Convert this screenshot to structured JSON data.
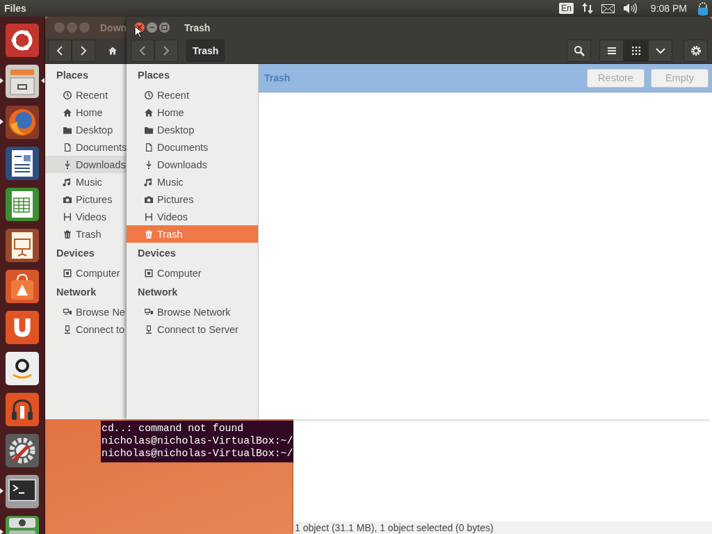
{
  "top_panel": {
    "app_name": "Files",
    "keyboard_layout": "En",
    "clock": "9:08 PM"
  },
  "launcher": [
    {
      "kind": "dash",
      "running": false,
      "focused": false
    },
    {
      "kind": "files",
      "running": true,
      "focused": true
    },
    {
      "kind": "firefox",
      "running": true,
      "focused": false
    },
    {
      "kind": "writer",
      "running": false,
      "focused": false
    },
    {
      "kind": "calc",
      "running": false,
      "focused": false
    },
    {
      "kind": "impress",
      "running": false,
      "focused": false
    },
    {
      "kind": "software",
      "running": false,
      "focused": false
    },
    {
      "kind": "ubuntu-one",
      "running": false,
      "focused": false
    },
    {
      "kind": "amazon",
      "running": false,
      "focused": false
    },
    {
      "kind": "music-store",
      "running": false,
      "focused": false
    },
    {
      "kind": "settings",
      "running": false,
      "focused": false
    },
    {
      "kind": "terminal",
      "running": true,
      "focused": false
    },
    {
      "kind": "stack",
      "running": true,
      "focused": false
    }
  ],
  "terminal": {
    "lines": [
      "cd..: command not found",
      "nicholas@nicholas-VirtualBox:~/",
      "nicholas@nicholas-VirtualBox:~/"
    ]
  },
  "status_window": {
    "status": "1 object (31.1 MB), 1 object selected (0 bytes)"
  },
  "back_window": {
    "title": "Down",
    "sidebar": [
      {
        "heading": "Places",
        "items": [
          {
            "label": "Recent",
            "kind": "recent",
            "selected": false
          },
          {
            "label": "Home",
            "kind": "home",
            "selected": false
          },
          {
            "label": "Desktop",
            "kind": "desktop",
            "selected": false
          },
          {
            "label": "Documents",
            "kind": "documents",
            "selected": false
          },
          {
            "label": "Downloads",
            "kind": "downloads",
            "selected": true
          },
          {
            "label": "Music",
            "kind": "music",
            "selected": false
          },
          {
            "label": "Pictures",
            "kind": "pictures",
            "selected": false
          },
          {
            "label": "Videos",
            "kind": "videos",
            "selected": false
          },
          {
            "label": "Trash",
            "kind": "trash",
            "selected": false
          }
        ]
      },
      {
        "heading": "Devices",
        "items": [
          {
            "label": "Computer",
            "kind": "computer",
            "selected": false
          }
        ]
      },
      {
        "heading": "Network",
        "items": [
          {
            "label": "Browse Ne",
            "kind": "network",
            "selected": false
          },
          {
            "label": "Connect to",
            "kind": "server",
            "selected": false
          }
        ]
      }
    ]
  },
  "trash_window": {
    "title": "Trash",
    "path": "Trash",
    "views": [
      {
        "kind": "list",
        "selected": false
      },
      {
        "kind": "grid",
        "selected": true
      }
    ],
    "info_bar": {
      "label": "Trash",
      "buttons": [
        {
          "label": "Restore",
          "disabled": true
        },
        {
          "label": "Empty",
          "disabled": true
        }
      ]
    },
    "sidebar": [
      {
        "heading": "Places",
        "items": [
          {
            "label": "Recent",
            "kind": "recent",
            "selected": false
          },
          {
            "label": "Home",
            "kind": "home",
            "selected": false
          },
          {
            "label": "Desktop",
            "kind": "desktop",
            "selected": false
          },
          {
            "label": "Documents",
            "kind": "documents",
            "selected": false
          },
          {
            "label": "Downloads",
            "kind": "downloads",
            "selected": false
          },
          {
            "label": "Music",
            "kind": "music",
            "selected": false
          },
          {
            "label": "Pictures",
            "kind": "pictures",
            "selected": false
          },
          {
            "label": "Videos",
            "kind": "videos",
            "selected": false
          },
          {
            "label": "Trash",
            "kind": "trash",
            "selected": true
          }
        ]
      },
      {
        "heading": "Devices",
        "items": [
          {
            "label": "Computer",
            "kind": "computer",
            "selected": false
          }
        ]
      },
      {
        "heading": "Network",
        "items": [
          {
            "label": "Browse Network",
            "kind": "network",
            "selected": false
          },
          {
            "label": "Connect to Server",
            "kind": "server",
            "selected": false
          }
        ]
      }
    ]
  }
}
